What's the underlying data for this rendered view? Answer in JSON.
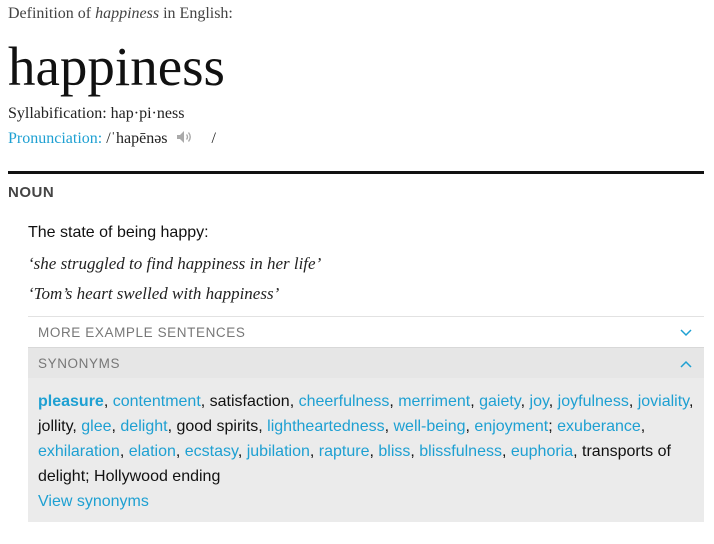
{
  "header": {
    "def_prefix": "Definition of",
    "word_italic": "happiness",
    "def_suffix": "in English:",
    "headword": "happiness",
    "syllabification_label": "Syllabification:",
    "syllabification": "hap·pi·ness",
    "pronunciation_label": "Pronunciation:",
    "pronunciation": "/ˈhapēnəs",
    "pronunciation_end": "/"
  },
  "entry": {
    "part_of_speech": "NOUN",
    "sense": "The state of being happy:",
    "examples": [
      "‘she struggled to find happiness in her life’",
      "‘Tom’s heart swelled with happiness’"
    ]
  },
  "sections": {
    "more_examples": "MORE EXAMPLE SENTENCES",
    "synonyms": "SYNONYMS"
  },
  "synonyms": [
    {
      "t": "pleasure",
      "link": true,
      "sep": ", "
    },
    {
      "t": "contentment",
      "link": true,
      "sep": ", "
    },
    {
      "t": "satisfaction",
      "link": false,
      "sep": ", "
    },
    {
      "t": "cheerfulness",
      "link": true,
      "sep": ", "
    },
    {
      "t": "merriment",
      "link": true,
      "sep": ", "
    },
    {
      "t": "gaiety",
      "link": true,
      "sep": ", "
    },
    {
      "t": "joy",
      "link": true,
      "sep": ", "
    },
    {
      "t": "joyfulness",
      "link": true,
      "sep": ", "
    },
    {
      "t": "joviality",
      "link": true,
      "sep": ", "
    },
    {
      "t": "jollity",
      "link": false,
      "sep": ", "
    },
    {
      "t": "glee",
      "link": true,
      "sep": ", "
    },
    {
      "t": "delight",
      "link": true,
      "sep": ", "
    },
    {
      "t": "good spirits",
      "link": false,
      "sep": ", "
    },
    {
      "t": "lightheartedness",
      "link": true,
      "sep": ", "
    },
    {
      "t": "well-being",
      "link": true,
      "sep": ", "
    },
    {
      "t": "enjoyment",
      "link": true,
      "sep": "; "
    },
    {
      "t": "exuberance",
      "link": true,
      "sep": ", "
    },
    {
      "t": "exhilaration",
      "link": true,
      "sep": ", "
    },
    {
      "t": "elation",
      "link": true,
      "sep": ", "
    },
    {
      "t": "ecstasy",
      "link": true,
      "sep": ", "
    },
    {
      "t": "jubilation",
      "link": true,
      "sep": ", "
    },
    {
      "t": "rapture",
      "link": true,
      "sep": ", "
    },
    {
      "t": "bliss",
      "link": true,
      "sep": ", "
    },
    {
      "t": "blissfulness",
      "link": true,
      "sep": ", "
    },
    {
      "t": "euphoria",
      "link": true,
      "sep": ", "
    },
    {
      "t": "transports of delight",
      "link": false,
      "sep": "; "
    },
    {
      "t": "Hollywood ending",
      "link": false,
      "sep": ""
    }
  ],
  "view_synonyms": "View synonyms",
  "colors": {
    "link": "#1ea0d2",
    "rule": "#111111",
    "panel": "#ebebeb"
  },
  "icons": {
    "pronunciation": "speaker-icon",
    "expand": "chevron-down-icon",
    "collapse": "chevron-up-icon"
  }
}
